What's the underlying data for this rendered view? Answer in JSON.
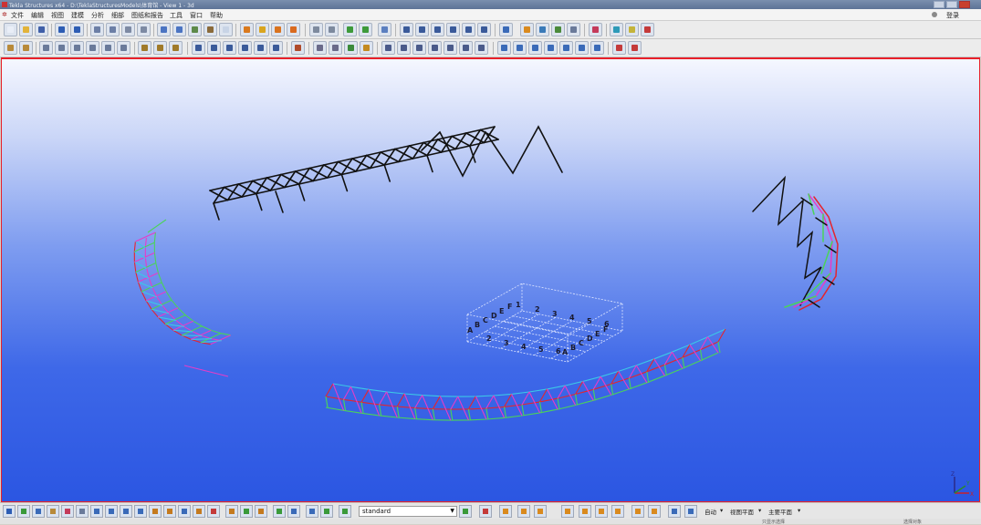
{
  "window": {
    "title": "Tekla Structures x64 - D:\\TeklaStructuresModels\\体育馆 - View 1 - 3d"
  },
  "menu": {
    "items": [
      "文件",
      "编辑",
      "视图",
      "建模",
      "分析",
      "细部",
      "图纸和报告",
      "工具",
      "窗口",
      "帮助"
    ],
    "login_label": "登录"
  },
  "viewport": {
    "grid_row_labels": [
      "A",
      "B",
      "C",
      "D",
      "E",
      "F"
    ],
    "grid_col_labels_top": [
      "1",
      "2",
      "3",
      "4",
      "5",
      "6"
    ],
    "grid_col_labels_bottom": [
      "2",
      "3",
      "4",
      "5",
      "6"
    ],
    "grid_row_labels_right": [
      "A",
      "B",
      "C",
      "D",
      "E",
      "F"
    ],
    "axis": {
      "z": "Z",
      "x": "X",
      "y": "Y"
    },
    "colors": {
      "top_truss": "#111111",
      "right_truss": "#111111",
      "red": "#e5242d",
      "magenta": "#e63cc8",
      "green": "#4bd35a",
      "cyan": "#3cc8e6",
      "grid": "#dfe6ff"
    }
  },
  "statusbar": {
    "view_select_value": "standard",
    "auto_label": "自动",
    "view_plane_label": "视图平面",
    "work_plane_label": "主要平面"
  },
  "bottomstrip": {
    "left_text": "只显示选择",
    "right_text": "选择对象"
  }
}
